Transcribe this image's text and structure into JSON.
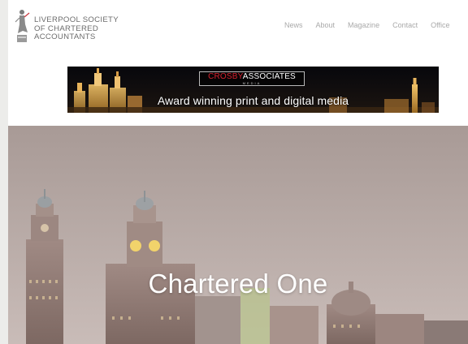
{
  "logo": {
    "lines": [
      "LIVERPOOL SOCIETY",
      "OF CHARTERED",
      "ACCOUNTANTS"
    ],
    "icon": "figure-emblem-icon",
    "accent": "#c6343c"
  },
  "nav": {
    "items": [
      "News",
      "About",
      "Magazine",
      "Contact",
      "Office"
    ]
  },
  "banner": {
    "brand_red": "CROSBY",
    "brand_white": "ASSOCIATES",
    "brand_sub": "MEDIA",
    "tagline": "Award winning print and digital media",
    "colors": {
      "brand_red": "#d8222f",
      "background": "#0b0b10"
    }
  },
  "hero": {
    "title": "Chartered One",
    "colors": {
      "sky_top": "#a89a96",
      "sky_bottom": "#c9bcb8"
    }
  }
}
